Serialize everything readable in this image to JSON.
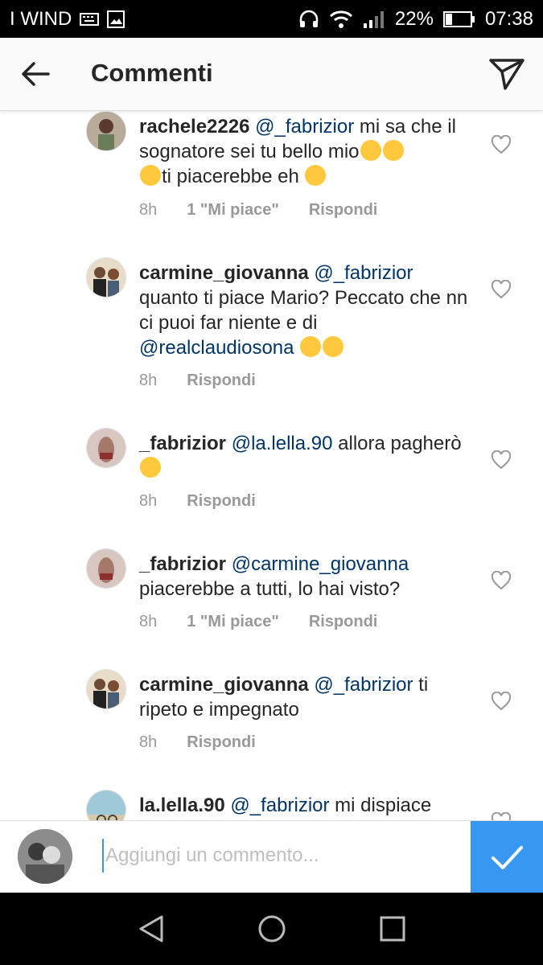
{
  "status_bar": {
    "carrier": "I WIND",
    "battery": "22%",
    "time": "07:38"
  },
  "header": {
    "title": "Commenti"
  },
  "comments": [
    {
      "username": "rachele2226",
      "mention": "@_fabrizior",
      "text": " mi sa che il sognatore sei tu bello mio",
      "text2": "ti piacerebbe eh",
      "emoji_mid": "grinning-emoji grinning-emoji grinning-emoji",
      "time": "8h",
      "likes": "1 \"Mi piace\"",
      "reply": "Rispondi"
    },
    {
      "username": "carmine_giovanna",
      "mention": "@_fabrizior",
      "text": " quanto ti piace Mario? Peccato che nn ci puoi far niente e di ",
      "mention2": "@realclaudiosona",
      "time": "8h",
      "likes": "",
      "reply": "Rispondi"
    },
    {
      "username": "_fabrizior",
      "mention": "@la.lella.90",
      "text": " allora pagherò",
      "time": "8h",
      "likes": "",
      "reply": "Rispondi"
    },
    {
      "username": "_fabrizior",
      "mention": "@carmine_giovanna",
      "text": " piacerebbe a tutti, lo hai visto?",
      "time": "8h",
      "likes": "1 \"Mi piace\"",
      "reply": "Rispondi"
    },
    {
      "username": "carmine_giovanna",
      "mention": "@_fabrizior",
      "text": " ti ripeto e impegnato",
      "time": "8h",
      "likes": "",
      "reply": "Rispondi"
    },
    {
      "username": "la.lella.90",
      "mention": "@_fabrizior",
      "text": " mi dispiace"
    }
  ],
  "composer": {
    "placeholder": "Aggiungi un commento..."
  },
  "colors": {
    "accent": "#3897f0",
    "mention": "#003569",
    "meta": "#999999"
  }
}
